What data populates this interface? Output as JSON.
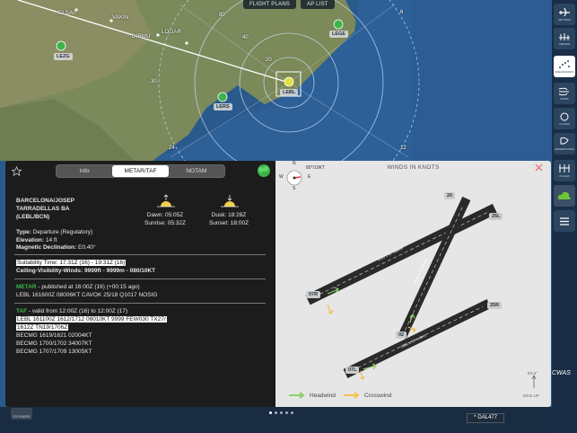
{
  "top_tabs": {
    "flight_plans": "FLIGHT PLANS",
    "ap_list": "AP LIST"
  },
  "map": {
    "cities": {
      "elsap": "ELSAP",
      "vakin": "VAKIN",
      "dirmu": "DIRMU",
      "logar": "LOGAR"
    },
    "airports": {
      "lezg": "LEZG",
      "lege": "LEGE",
      "lers": "LERS",
      "lebl": "LEBL"
    },
    "ring_labels": {
      "r80": "80",
      "r60": "60",
      "r40": "40",
      "r20": "20",
      "r24": "24",
      "r12": "12",
      "r6": "6",
      "r30": "30"
    }
  },
  "toolbar": {
    "items": [
      {
        "label": "SETTINGS",
        "icon": "plane-settings-icon"
      },
      {
        "label": "TERRAIN",
        "icon": "terrain-icon"
      },
      {
        "label": "FREQ/NAVAIDS",
        "icon": "navaids-icon"
      },
      {
        "label": "WINDS",
        "icon": "winds-icon"
      },
      {
        "label": "CLOUDS",
        "icon": "clouds-icon"
      },
      {
        "label": "OBSERVATIONS",
        "icon": "observations-icon"
      },
      {
        "label": "PLACES",
        "icon": "places-icon"
      },
      {
        "label": "",
        "icon": "cloud-icon"
      },
      {
        "label": "",
        "icon": "menu-icon"
      }
    ]
  },
  "panel": {
    "tabs": {
      "info": "Info",
      "metar_taf": "METAR/TAF",
      "notam": "NOTAM"
    },
    "airport_name_1": "BARCELONA/JOSEP",
    "airport_name_2": "TARRADELLAS BA",
    "airport_code": "(LEBL/BCN)",
    "dawn": "Dawn: 05:05Z",
    "sunrise": "Sunrise: 05:32Z",
    "dusk": "Dusk: 18:28Z",
    "sunset": "Sunset: 18:00Z",
    "type_label": "Type:",
    "type_value": "Departure (Regulatory)",
    "elevation_label": "Elevation:",
    "elevation_value": "14 ft",
    "magdec_label": "Magnetic Declination:",
    "magdec_value": "E0.40°",
    "suitability": "Suitability Time: 17:31Z (16) - 19:31Z (16)",
    "cvw": "Ceiling-Visibility-Winds: 9999ft - 9999m - 080/10KT",
    "metar_label": "METAR",
    "metar_pub": " - published at 16:00Z (16) (+00:15 ago)",
    "metar_text": "LEBL 161600Z 08006KT CAVOK 25/18 Q1017 NOSIG",
    "taf_label": "TAF",
    "taf_valid": " - valid from 12:00Z (16) to 12:00Z (17)",
    "taf_line1": "LEBL 161100Z 1612/1712 08010KT 9999 FEW030 TX27/",
    "taf_line2": "1612Z TN19/1706Z",
    "taf_line3": "BECMG 1619/1621 02004KT",
    "taf_line4": "BECMG 1700/1702 34007KT",
    "taf_line5": "BECMG 1707/1709 13005KT"
  },
  "winds": {
    "title": "WINDS IN KNOTS",
    "wind_readout": "80°/10KT",
    "compass": {
      "n": "N",
      "s": "S",
      "e": "E",
      "w": "W"
    },
    "mag_up": "MAG UP",
    "mag_value": "E0.4°",
    "legend_headwind": "Headwind",
    "legend_crosswind": "Crosswind",
    "headwind_color": "#8fd06a",
    "crosswind_color": "#f2c14e",
    "runway_labels": {
      "rw02": "02",
      "rw20": "20",
      "rw07l": "07L",
      "rw25r": "25R",
      "rw07r": "07R",
      "rw25l": "25L"
    },
    "runway_info": {
      "rw0725r": "3190 x 60 meters",
      "rw0220": "2528 x 45 meters",
      "rw0725l": "2660 x 60 meters"
    }
  },
  "bottom": {
    "flight_tag": "DAL477",
    "finder": "EX FINDER",
    "brand": "CWAS"
  }
}
